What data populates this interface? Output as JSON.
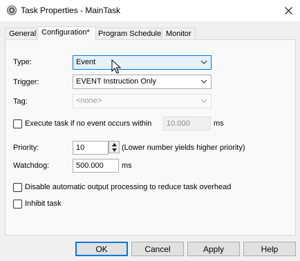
{
  "window": {
    "title": "Task Properties - MainTask",
    "app_icon": "gear-icon",
    "close_icon": "close-icon"
  },
  "tabs": [
    {
      "label": "General",
      "active": false
    },
    {
      "label": "Configuration*",
      "active": true
    },
    {
      "label": "Program Schedule",
      "active": false
    },
    {
      "label": "Monitor",
      "active": false
    }
  ],
  "form": {
    "type_label": "Type:",
    "type_value": "Event",
    "trigger_label": "Trigger:",
    "trigger_value": "EVENT Instruction Only",
    "tag_label": "Tag:",
    "tag_value": "<none>",
    "execute_label": "Execute task if no event occurs within",
    "execute_checked": false,
    "execute_value": "10.000",
    "execute_unit": "ms",
    "priority_label": "Priority:",
    "priority_value": "10",
    "priority_hint": "(Lower number yields higher priority)",
    "watchdog_label": "Watchdog:",
    "watchdog_value": "500.000",
    "watchdog_unit": "ms",
    "disable_output_label": "Disable automatic output processing to reduce task overhead",
    "disable_output_checked": false,
    "inhibit_label": "Inhibit task",
    "inhibit_checked": false
  },
  "buttons": {
    "ok": "OK",
    "cancel": "Cancel",
    "apply": "Apply",
    "help": "Help"
  },
  "colors": {
    "focus_accent": "#0078d7",
    "focused_combo_bg": "#e5f1fb"
  }
}
